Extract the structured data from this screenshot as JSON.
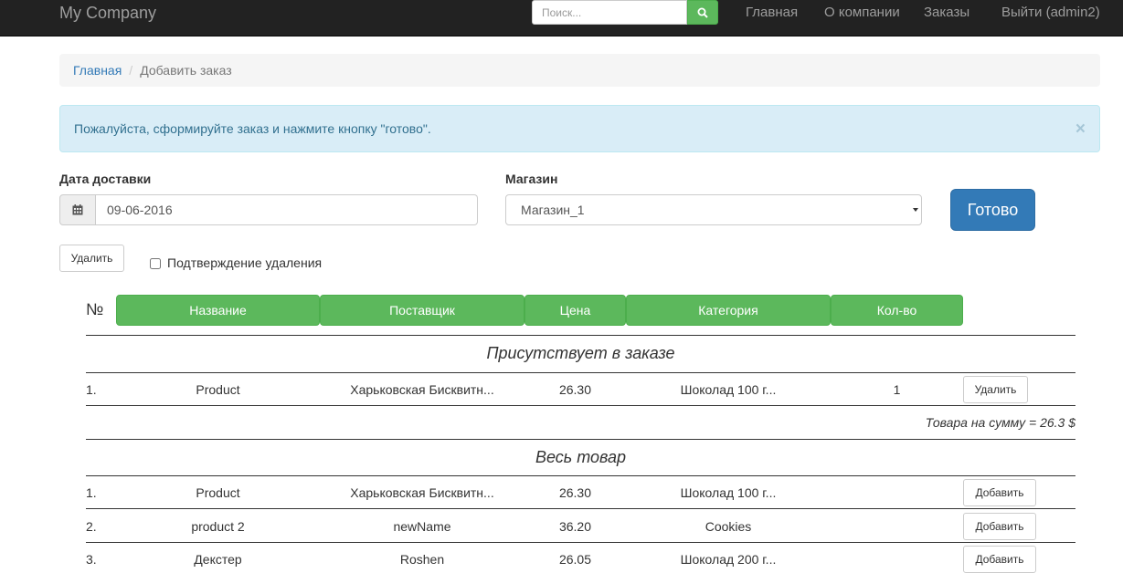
{
  "navbar": {
    "brand": "My Company",
    "search_placeholder": "Поиск...",
    "links": [
      "Главная",
      "О компании",
      "Заказы",
      "Выйти (admin2)"
    ]
  },
  "breadcrumb": {
    "home": "Главная",
    "separator": "/",
    "current": "Добавить заказ"
  },
  "alert": {
    "text": "Пожалуйста, сформируйте заказ и нажмите кнопку \"готово\".",
    "close": "×"
  },
  "form": {
    "date_label": "Дата доставки",
    "date_value": "09-06-2016",
    "shop_label": "Магазин",
    "shop_value": "Магазин_1",
    "submit": "Готово",
    "delete": "Удалить",
    "confirm_delete": "Подтверждение удаления"
  },
  "table": {
    "num_header": "№",
    "headers": [
      "Название",
      "Поставщик",
      "Цена",
      "Категория",
      "Кол-во"
    ],
    "in_order_title": "Присутствует в заказе",
    "in_order_rows": [
      {
        "num": "1.",
        "name": "Product",
        "supplier": "Харьковская Бисквитн...",
        "price": "26.30",
        "category": "Шоколад 100 г...",
        "qty": "1",
        "action": "Удалить"
      }
    ],
    "total": "Товара на сумму = 26.3 $",
    "all_title": "Весь товар",
    "all_rows": [
      {
        "num": "1.",
        "name": "Product",
        "supplier": "Харьковская Бисквитн...",
        "price": "26.30",
        "category": "Шоколад 100 г...",
        "action": "Добавить"
      },
      {
        "num": "2.",
        "name": "product 2",
        "supplier": "newName",
        "price": "36.20",
        "category": "Cookies",
        "action": "Добавить"
      },
      {
        "num": "3.",
        "name": "Декстер",
        "supplier": "Roshen",
        "price": "26.05",
        "category": "Шоколад 200 г...",
        "action": "Добавить"
      }
    ]
  },
  "colors": {
    "navbar": "#222222",
    "green": "#5cb85c",
    "primary": "#337ab7",
    "alert_bg": "#d9edf7"
  }
}
